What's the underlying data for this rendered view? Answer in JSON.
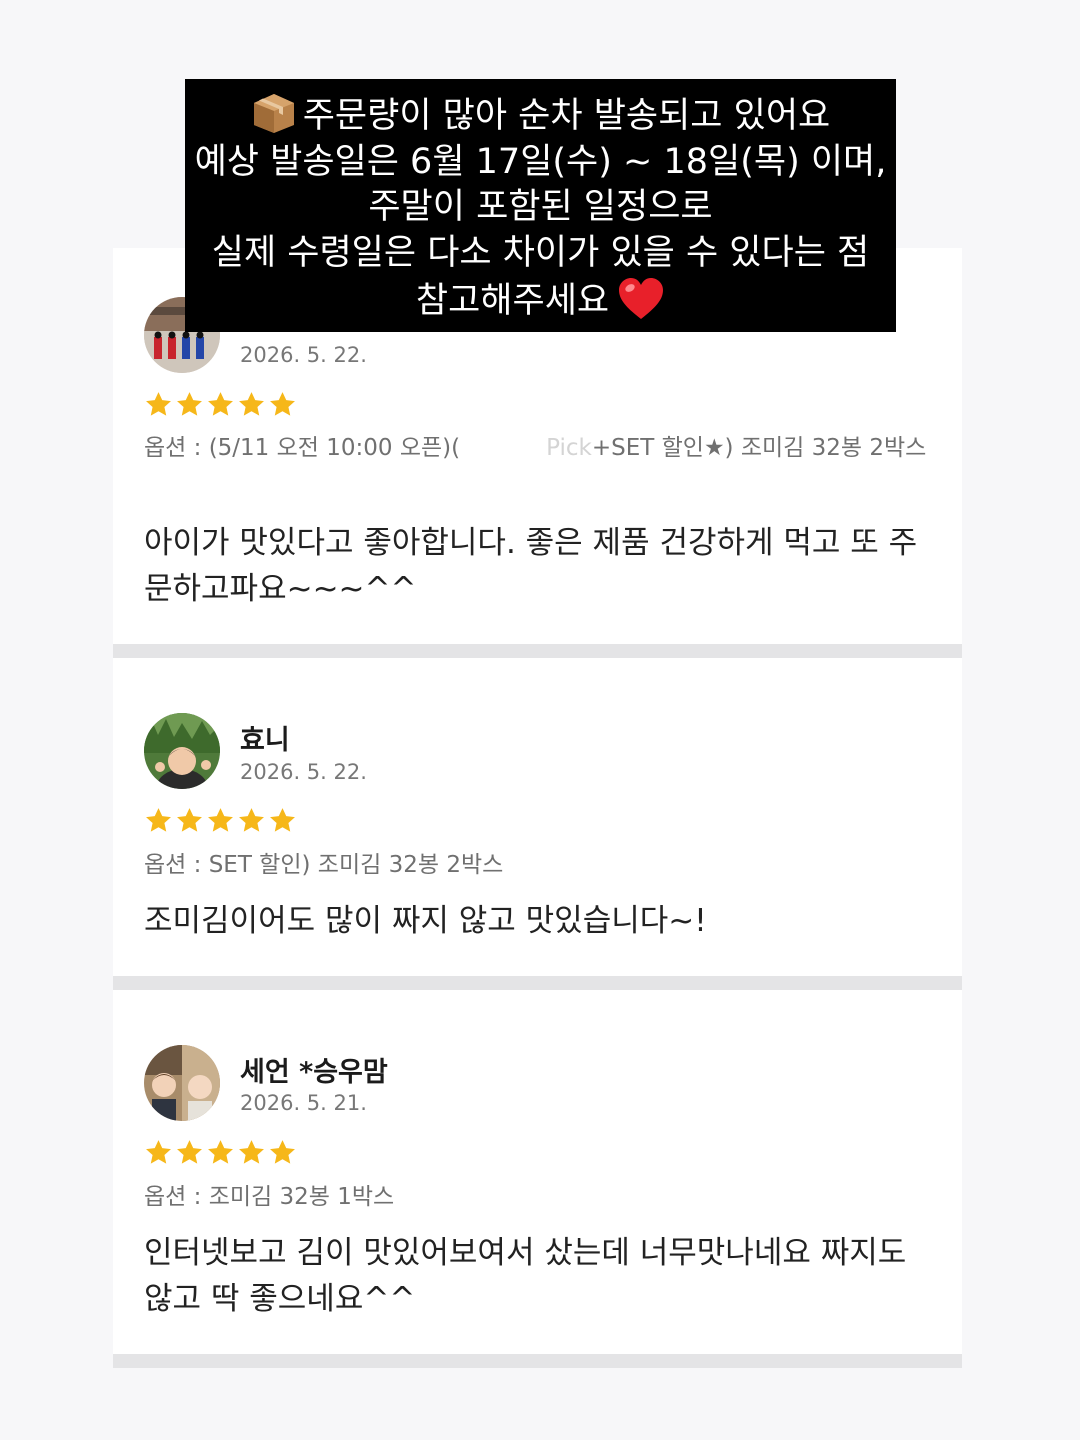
{
  "notice": {
    "box_icon": "package-emoji",
    "line1": "주문량이 많아 순차 발송되고 있어요",
    "line2": "예상 발송일은 6월 17일(수) ~ 18일(목) 이며,",
    "line3": "주말이 포함된 일정으로",
    "line4": "실제 수령일은 다소 차이가 있을 수 있다는 점",
    "line5": "참고해주세요",
    "heart_icon": "red-heart-emoji"
  },
  "reviews": [
    {
      "name": "",
      "date": "2026. 5. 22.",
      "rating": 5,
      "option_prefix": "옵션 : (5/11 오전 10:00 오픈)(",
      "option_faded": "Pick",
      "option_suffix": "+SET 할인★) 조미김 32봉 2박스",
      "text": "아이가 맛있다고 좋아합니다. 좋은 제품 건강하게 먹고 또 주문하고파요~~~^^",
      "avatar_icon": "palace-guards-avatar"
    },
    {
      "name": "효니",
      "date": "2026. 5. 22.",
      "rating": 5,
      "option": "옵션 : SET 할인) 조미김 32봉 2박스",
      "text": "조미김이어도 많이 짜지 않고 맛있습니다~!",
      "avatar_icon": "child-outdoors-avatar"
    },
    {
      "name": "세언 *승우맘",
      "date": "2026. 5. 21.",
      "rating": 5,
      "option": "옵션 : 조미김 32봉 1박스",
      "text": "인터넷보고 김이 맛있어보여서 샀는데 너무맛나네요 짜지도 않고 딱 좋으네요^^",
      "avatar_icon": "two-kids-avatar"
    }
  ],
  "colors": {
    "star": "#f6b719",
    "card_separator": "#e4e4e6",
    "notice_bg": "#000000"
  }
}
